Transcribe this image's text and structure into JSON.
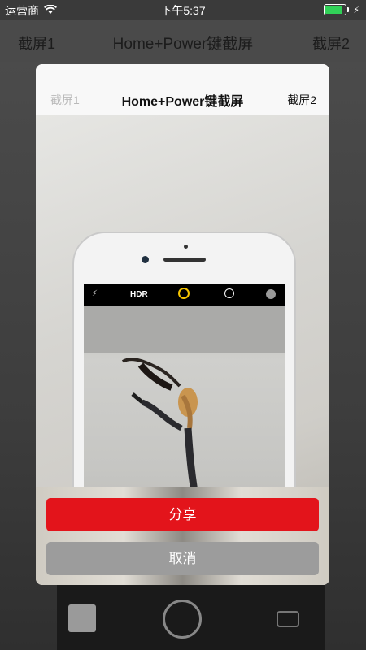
{
  "status_bar": {
    "carrier": "运营商",
    "time": "下午5:37"
  },
  "background_nav": {
    "left": "截屏1",
    "title": "Home+Power键截屏",
    "right": "截屏2"
  },
  "modal": {
    "header": {
      "left": "截屏1",
      "title": "Home+Power键截屏",
      "right": "截屏2"
    },
    "camera_ui": {
      "flash_icon": "⚡",
      "hdr_label": "HDR"
    },
    "buttons": {
      "share": "分享",
      "cancel": "取消"
    }
  },
  "colors": {
    "share": "#e3141b",
    "cancel": "#9c9c9c",
    "battery": "#31d158"
  }
}
